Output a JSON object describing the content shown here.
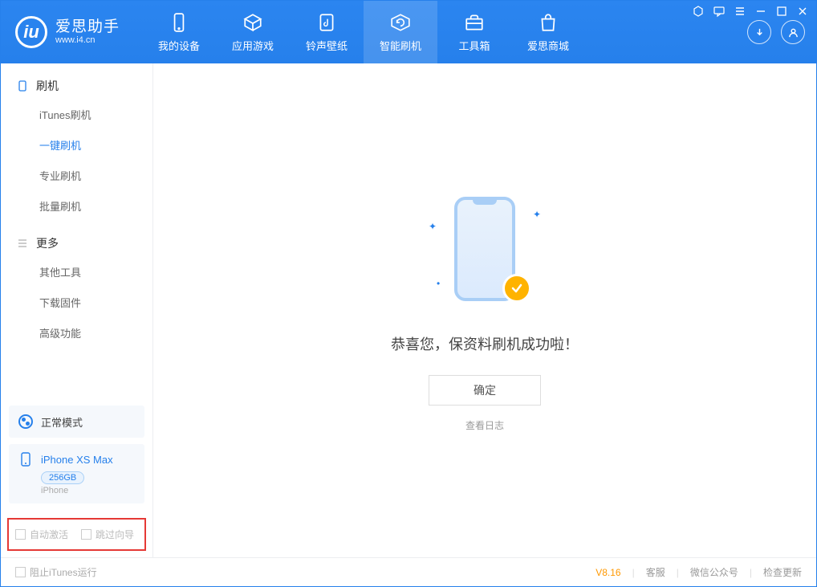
{
  "brand": {
    "title": "爱思助手",
    "subtitle": "www.i4.cn"
  },
  "nav": {
    "my_device": "我的设备",
    "apps_games": "应用游戏",
    "ringtone": "铃声壁纸",
    "flash": "智能刷机",
    "toolbox": "工具箱",
    "store": "爱思商城"
  },
  "sidebar": {
    "section_flash": "刷机",
    "items_flash": [
      "iTunes刷机",
      "一键刷机",
      "专业刷机",
      "批量刷机"
    ],
    "section_more": "更多",
    "items_more": [
      "其他工具",
      "下载固件",
      "高级功能"
    ]
  },
  "device": {
    "mode": "正常模式",
    "name": "iPhone XS Max",
    "storage": "256GB",
    "type": "iPhone"
  },
  "checks": {
    "auto_activate": "自动激活",
    "skip_guide": "跳过向导"
  },
  "main": {
    "success_msg": "恭喜您，保资料刷机成功啦！",
    "ok": "确定",
    "view_log": "查看日志"
  },
  "footer": {
    "block_itunes": "阻止iTunes运行",
    "version": "V8.16",
    "support": "客服",
    "wechat": "微信公众号",
    "update": "检查更新"
  }
}
